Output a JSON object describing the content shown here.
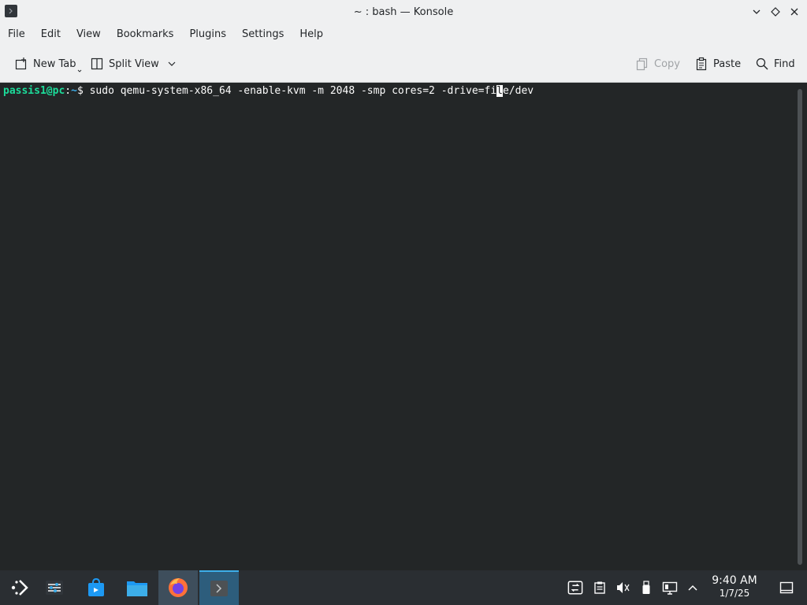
{
  "window": {
    "title": "~ : bash — Konsole"
  },
  "menubar": {
    "items": [
      "File",
      "Edit",
      "View",
      "Bookmarks",
      "Plugins",
      "Settings",
      "Help"
    ]
  },
  "toolbar": {
    "new_tab_label": "New Tab",
    "split_view_label": "Split View",
    "copy_label": "Copy",
    "paste_label": "Paste",
    "find_label": "Find"
  },
  "terminal": {
    "prompt_user": "passis1@pc",
    "prompt_sep": ":",
    "prompt_path": "~",
    "prompt_symbol": "$ ",
    "command_before_cursor": "sudo qemu-system-x86_64 -enable-kvm -m 2048 -smp cores=2 -drive=fi",
    "cursor_char": "l",
    "command_after_cursor": "e/dev"
  },
  "taskbar": {
    "apps": [
      {
        "icon": "app-launcher-icon"
      },
      {
        "icon": "system-settings-icon"
      },
      {
        "icon": "discover-store-icon"
      },
      {
        "icon": "dolphin-folder-icon"
      },
      {
        "icon": "firefox-icon"
      },
      {
        "icon": "konsole-terminal-icon"
      }
    ],
    "clock_time": "9:40 AM",
    "clock_date": "1/7/25"
  },
  "colors": {
    "accent": "#3daee9",
    "prompt_user": "#1cdc9a",
    "terminal_bg": "#232627"
  }
}
